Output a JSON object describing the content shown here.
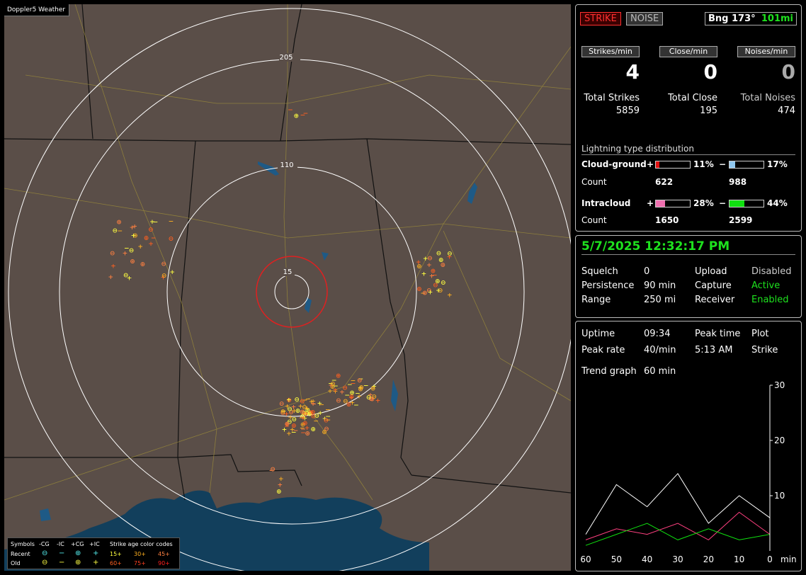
{
  "map": {
    "title": "Doppler5 Weather",
    "ring_labels": [
      "205",
      "110",
      "15"
    ],
    "legend": {
      "symbols_label": "Symbols",
      "cols": [
        "-CG",
        "-IC",
        "+CG",
        "+IC"
      ],
      "age_title": "Strike age color codes",
      "recent_label": "Recent",
      "old_label": "Old",
      "recent_ages": [
        "15+",
        "30+",
        "45+"
      ],
      "old_ages": [
        "60+",
        "75+",
        "90+"
      ],
      "age_colors": [
        "#ffff40",
        "#ffb020",
        "#ff8040",
        "#ff6020",
        "#ff4020",
        "#ff2020"
      ]
    }
  },
  "status": {
    "strike_btn": "STRIKE",
    "noise_btn": "NOISE",
    "bearing": "Bng 173°",
    "distance": "101mi",
    "rate_headers": [
      "Strikes/min",
      "Close/min",
      "Noises/min"
    ],
    "rates": [
      "4",
      "0",
      "0"
    ],
    "total_labels": [
      "Total Strikes",
      "Total Close",
      "Total Noises"
    ],
    "totals": [
      "5859",
      "195",
      "474"
    ]
  },
  "distribution": {
    "title": "Lightning type distribution",
    "cg_label": "Cloud-ground",
    "ic_label": "Intracloud",
    "count_label": "Count",
    "plus": "+",
    "minus": "−",
    "cg_pos_pct": "11%",
    "cg_neg_pct": "17%",
    "ic_pos_pct": "28%",
    "ic_neg_pct": "44%",
    "cg_pos_fraction": 0.11,
    "cg_neg_fraction": 0.17,
    "ic_pos_fraction": 0.28,
    "ic_neg_fraction": 0.44,
    "cg_pos_count": "622",
    "cg_neg_count": "988",
    "ic_pos_count": "1650",
    "ic_neg_count": "2599",
    "colors": {
      "cg_pos": "#e01010",
      "cg_neg": "#90c8f0",
      "ic_pos": "#f070b0",
      "ic_neg": "#10e010"
    }
  },
  "settings": {
    "datetime": "5/7/2025 12:32:17 PM",
    "rows": [
      {
        "k": "Squelch",
        "v": "0",
        "k2": "Upload",
        "v2": "Disabled"
      },
      {
        "k": "Persistence",
        "v": "90 min",
        "k2": "Capture",
        "v2": "Active"
      },
      {
        "k": "Range",
        "v": "250 mi",
        "k2": "Receiver",
        "v2": "Enabled"
      }
    ]
  },
  "trend": {
    "uptime_label": "Uptime",
    "uptime": "09:34",
    "peak_time_label": "Peak time",
    "peak_time": "5:13 AM",
    "plot_label": "Plot",
    "plot": "Strike",
    "peak_rate_label": "Peak rate",
    "peak_rate": "40/min",
    "trend_label": "Trend graph",
    "trend": "60 min",
    "y_ticks": [
      "30",
      "20",
      "10"
    ],
    "x_ticks": [
      "60",
      "50",
      "40",
      "30",
      "20",
      "10",
      "0"
    ],
    "x_unit": "min"
  },
  "chart_data": {
    "type": "line",
    "x": [
      60,
      50,
      40,
      30,
      20,
      10,
      0
    ],
    "ylim": [
      0,
      30
    ],
    "xlim": [
      60,
      0
    ],
    "series": [
      {
        "color": "#ffffff",
        "values": [
          3,
          12,
          8,
          14,
          5,
          10,
          6
        ]
      },
      {
        "color": "#ff4080",
        "values": [
          2,
          4,
          3,
          5,
          2,
          7,
          3
        ]
      },
      {
        "color": "#10e010",
        "values": [
          1,
          3,
          5,
          2,
          4,
          2,
          3
        ]
      }
    ]
  }
}
